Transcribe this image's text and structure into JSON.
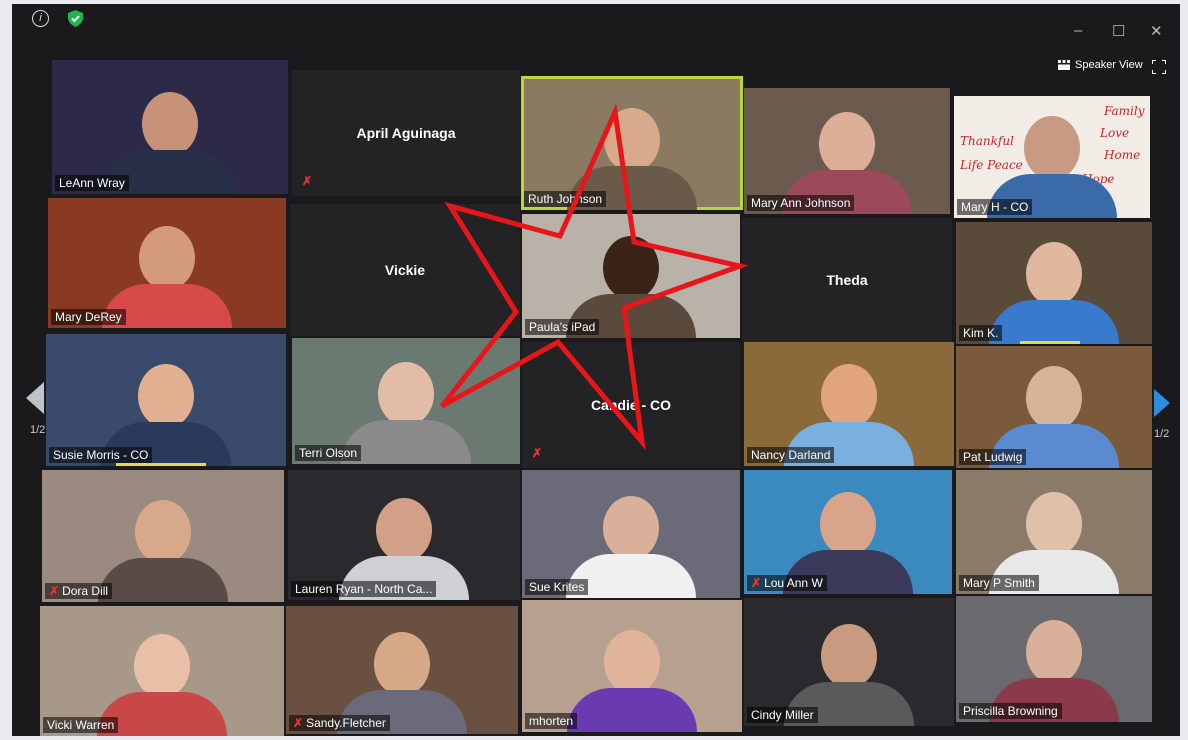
{
  "toolbar": {
    "speaker_view_label": "Speaker View",
    "page_indicator": "1/2"
  },
  "participants": [
    {
      "name": "LeAnn Wray",
      "muted": false,
      "video": true
    },
    {
      "name": "April Aguinaga",
      "muted": true,
      "video": false
    },
    {
      "name": "Ruth Johnson",
      "muted": false,
      "video": true,
      "active_speaker": true
    },
    {
      "name": "Mary Ann Johnson",
      "muted": false,
      "video": true
    },
    {
      "name": "Mary H - CO",
      "muted": false,
      "video": true
    },
    {
      "name": "Mary DeRey",
      "muted": false,
      "video": true
    },
    {
      "name": "Vickie",
      "muted": false,
      "video": false
    },
    {
      "name": "Paula's iPad",
      "muted": false,
      "video": true
    },
    {
      "name": "Theda",
      "muted": false,
      "video": false
    },
    {
      "name": "Kim K.",
      "muted": false,
      "video": true
    },
    {
      "name": "Susie Morris - CO",
      "muted": false,
      "video": true
    },
    {
      "name": "Terri Olson",
      "muted": false,
      "video": true
    },
    {
      "name": "Candie - CO",
      "muted": true,
      "video": false
    },
    {
      "name": "Nancy Darland",
      "muted": false,
      "video": true
    },
    {
      "name": "Pat Ludwig",
      "muted": false,
      "video": true
    },
    {
      "name": "Dora Dill",
      "muted": true,
      "video": true
    },
    {
      "name": "Lauren Ryan - North Ca...",
      "muted": false,
      "video": true
    },
    {
      "name": "Sue Krites",
      "muted": false,
      "video": true
    },
    {
      "name": "Lou Ann W",
      "muted": true,
      "video": true
    },
    {
      "name": "Mary P Smith",
      "muted": false,
      "video": true
    },
    {
      "name": "Vicki Warren",
      "muted": false,
      "video": true
    },
    {
      "name": "Sandy.Fletcher",
      "muted": true,
      "video": true
    },
    {
      "name": "mhorten",
      "muted": false,
      "video": true
    },
    {
      "name": "Cindy Miller",
      "muted": false,
      "video": true
    },
    {
      "name": "Priscilla Browning",
      "muted": false,
      "video": true
    }
  ],
  "sign_text": {
    "line1": "Family",
    "line2": "Thankful",
    "line3": "Love",
    "line4": "Life Peace",
    "line5": "Home",
    "line6": "Hope"
  },
  "colors": {
    "annotation_star": "#e8151b",
    "active_speaker_border": "#b8d83a",
    "muted_icon": "#e33333",
    "next_page_arrow": "#2b8ce0"
  }
}
